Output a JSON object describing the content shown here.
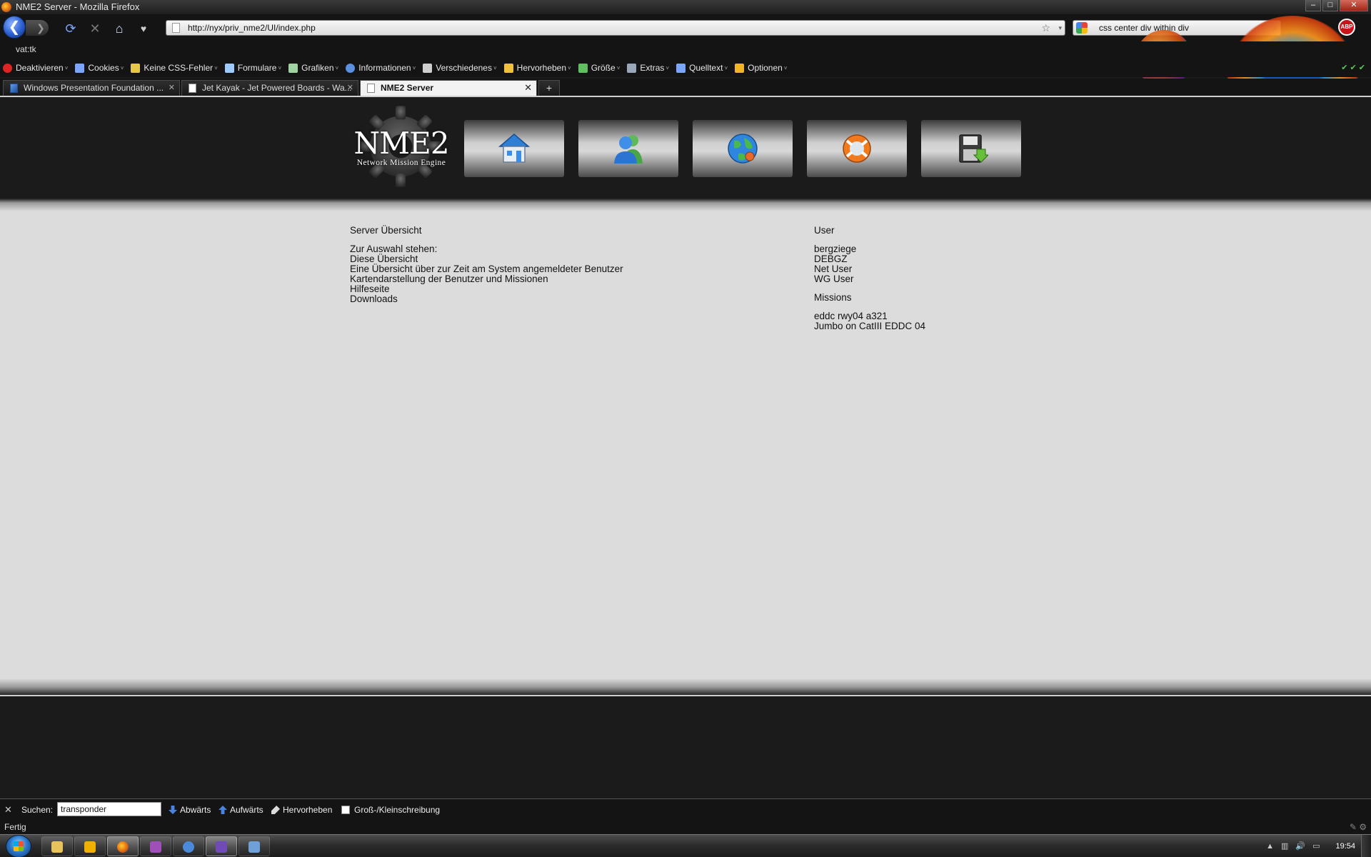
{
  "window": {
    "title": "NME2 Server - Mozilla Firefox",
    "controls": {
      "minimize": "–",
      "maximize": "□",
      "close": "✕"
    }
  },
  "toolbar": {
    "url": "http://nyx/priv_nme2/UI/index.php",
    "search_query": "css center div within div",
    "back_glyph": "❮",
    "forward_glyph": "❯",
    "reload_glyph": "⟳",
    "stop_glyph": "✕",
    "home_glyph": "⌂",
    "addon_glyph": "♥",
    "star_glyph": "☆",
    "dropdown_glyph": "▾",
    "search_glyph": "⌕",
    "adblock_label": "ABP"
  },
  "bookmarks": {
    "item": "vat:tk"
  },
  "devbar": {
    "items": [
      {
        "label": "Deaktivieren",
        "color": "#e02424",
        "icon": "disable-icon"
      },
      {
        "label": "Cookies",
        "color": "#7aa6ff",
        "icon": "cookie-icon"
      },
      {
        "label": "Keine CSS-Fehler",
        "color": "#e6c74a",
        "icon": "css-icon"
      },
      {
        "label": "Formulare",
        "color": "#9ecbff",
        "icon": "form-icon"
      },
      {
        "label": "Grafiken",
        "color": "#9fd39f",
        "icon": "image-icon"
      },
      {
        "label": "Informationen",
        "color": "#5b8fe0",
        "icon": "info-icon"
      },
      {
        "label": "Verschiedenes",
        "color": "#cfcfcf",
        "icon": "misc-icon"
      },
      {
        "label": "Hervorheben",
        "color": "#f0c040",
        "icon": "highlight-icon"
      },
      {
        "label": "Größe",
        "color": "#5ec05e",
        "icon": "resize-icon"
      },
      {
        "label": "Extras",
        "color": "#9aa7b8",
        "icon": "tools-icon"
      },
      {
        "label": "Quelltext",
        "color": "#7aa6ff",
        "icon": "source-icon"
      },
      {
        "label": "Optionen",
        "color": "#f0b429",
        "icon": "options-icon"
      }
    ],
    "dropdown_glyph": "˅"
  },
  "persona": {
    "checks": "✔ ✔ ✔"
  },
  "tabs": [
    {
      "label": "Windows Presentation Foundation ...",
      "active": false
    },
    {
      "label": "Jet Kayak - Jet Powered Boards - Wa...",
      "active": false
    },
    {
      "label": "NME2 Server",
      "active": true
    }
  ],
  "tab_close_glyph": "✕",
  "new_tab_glyph": "+",
  "site": {
    "logo_title": "NME2",
    "logo_subtitle": "Network Mission Engine",
    "nav_buttons": [
      "home-icon",
      "users-icon",
      "globe-icon",
      "help-icon",
      "download-icon"
    ]
  },
  "overview": {
    "heading": "Server Übersicht",
    "intro": "Zur Auswahl stehen:",
    "links": [
      "Diese Übersicht",
      "Eine Übersicht über zur Zeit am System angemeldeter Benutzer",
      "Kartendarstellung der Benutzer und Missionen",
      "Hilfeseite",
      "Downloads"
    ]
  },
  "users": {
    "heading": "User",
    "items": [
      "bergziege",
      "DEBGZ",
      "Net User",
      "WG User"
    ]
  },
  "missions": {
    "heading": "Missions",
    "items": [
      "eddc rwy04 a321",
      "Jumbo on CatIII EDDC 04"
    ]
  },
  "findbar": {
    "close_glyph": "✕",
    "label": "Suchen:",
    "value": "transponder",
    "down": "Abwärts",
    "up": "Aufwärts",
    "highlight": "Hervorheben",
    "case": "Groß-/Kleinschreibung"
  },
  "statusbar": {
    "text": "Fertig",
    "right_icons": "✎ ⚙"
  },
  "taskbar": {
    "tray_arrow": "▲",
    "tray_icons": [
      "▥",
      "🔊",
      "▭"
    ],
    "clock": "19:54"
  }
}
